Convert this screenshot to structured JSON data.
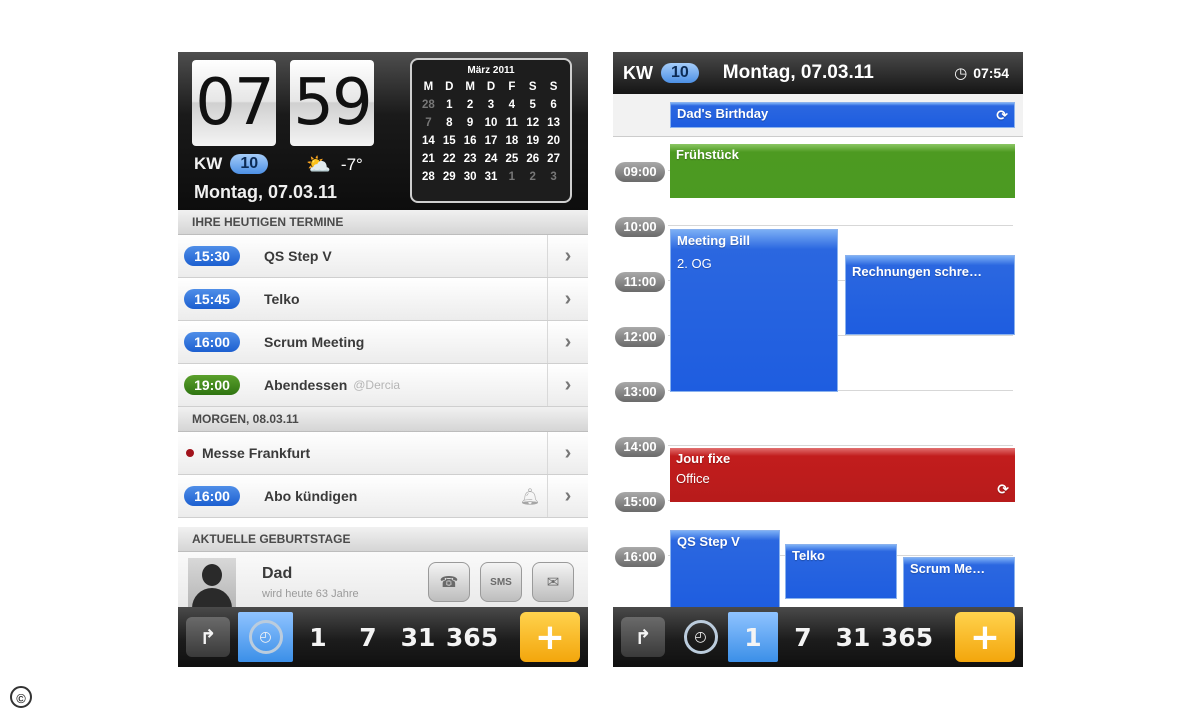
{
  "left": {
    "clock": {
      "hour": "07",
      "minute": "59"
    },
    "kw_label": "KW",
    "kw_number": "10",
    "weather": {
      "icon": "sun-cloud-icon",
      "temp": "-7°"
    },
    "date": "Montag, 07.03.11",
    "calendar": {
      "title": "März 2011",
      "weekdays": [
        "M",
        "D",
        "M",
        "D",
        "F",
        "S",
        "S"
      ],
      "weeks": [
        [
          "28",
          "1",
          "2",
          "3",
          "4",
          "5",
          "6"
        ],
        [
          "7",
          "8",
          "9",
          "10",
          "11",
          "12",
          "13"
        ],
        [
          "14",
          "15",
          "16",
          "17",
          "18",
          "19",
          "20"
        ],
        [
          "21",
          "22",
          "23",
          "24",
          "25",
          "26",
          "27"
        ],
        [
          "28",
          "29",
          "30",
          "31",
          "1",
          "2",
          "3"
        ]
      ]
    },
    "sections": {
      "today": "IHRE HEUTIGEN TERMINE",
      "tomorrow": "MORGEN, 08.03.11",
      "birthdays": "AKTUELLE GEBURTSTAGE"
    },
    "today_events": [
      {
        "time": "15:30",
        "title": "QS Step V",
        "sub": ""
      },
      {
        "time": "15:45",
        "title": "Telko",
        "sub": ""
      },
      {
        "time": "16:00",
        "title": "Scrum Meeting",
        "sub": ""
      },
      {
        "time": "19:00",
        "title": "Abendessen",
        "sub": "@Dercia"
      }
    ],
    "tomorrow_events": [
      {
        "time": "",
        "title": "Messe Frankfurt"
      },
      {
        "time": "16:00",
        "title": "Abo kündigen"
      }
    ],
    "birthday": {
      "name": "Dad",
      "info": "wird heute 63 Jahre",
      "sms": "SMS"
    },
    "toolbar": {
      "day": "1",
      "week": "7",
      "month": "31",
      "year": "365",
      "add": "+"
    }
  },
  "right": {
    "kw_label": "KW",
    "kw_number": "10",
    "date": "Montag, 07.03.11",
    "time": "07:54",
    "allday_event": "Dad's Birthday",
    "hours": [
      "09:00",
      "10:00",
      "11:00",
      "12:00",
      "13:00",
      "14:00",
      "15:00",
      "16:00"
    ],
    "events": {
      "fruehstueck": "Frühstück",
      "meeting_bill": "Meeting Bill",
      "meeting_bill_loc": "2. OG",
      "rechnungen": "Rechnungen schre…",
      "jour_fixe": "Jour fixe",
      "jour_fixe_loc": "Office",
      "qs_step": "QS Step V",
      "telko": "Telko",
      "scrum": "Scrum Me…"
    },
    "toolbar": {
      "day": "1",
      "week": "7",
      "month": "31",
      "year": "365",
      "add": "+"
    }
  },
  "copyright": "©",
  "colors": {
    "blue": "#1e5de0",
    "green": "#4b9a22",
    "red": "#b71b1b",
    "add": "#f3a60c"
  }
}
